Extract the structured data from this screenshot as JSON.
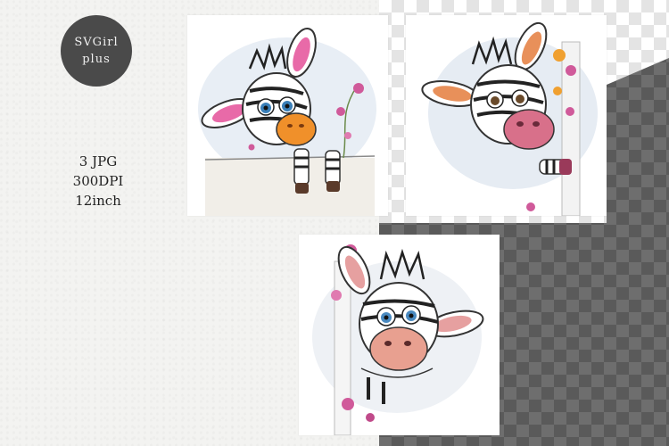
{
  "badge": {
    "line1": "SVGirl",
    "line2": "plus"
  },
  "product_info": {
    "format": "3 JPG",
    "resolution": "300DPI",
    "size": "12inch"
  },
  "colors": {
    "badge": "#4a4a4a",
    "nose_orange": "#f0902a",
    "nose_pink": "#d8708a",
    "flower_pink": "#d05a9a",
    "flower_orange": "#f0a030"
  },
  "illustrations": [
    {
      "subject": "zebra-peeking-over-wall"
    },
    {
      "subject": "zebra-peeking-from-side"
    },
    {
      "subject": "zebra-peeking-from-corner"
    }
  ]
}
